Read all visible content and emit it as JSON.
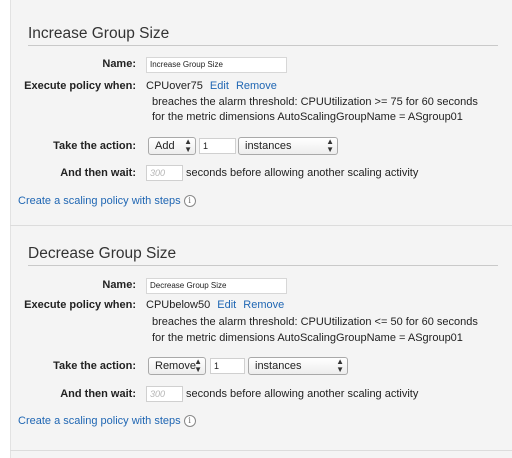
{
  "policies": [
    {
      "title": "Increase Group Size",
      "name_label": "Name:",
      "name_value": "Increase Group Size",
      "execute_label": "Execute policy when:",
      "alarm_name": "CPUover75",
      "edit_label": "Edit",
      "remove_label": "Remove",
      "breach_text": "breaches the alarm threshold: CPUUtilization >= 75 for 60 seconds",
      "dimension_text": "for the metric dimensions AutoScalingGroupName = ASgroup01",
      "action_label": "Take the action:",
      "action_value": "Add",
      "amount_value": "1",
      "unit_value": "instances",
      "wait_label": "And then wait:",
      "wait_placeholder": "300",
      "wait_suffix": "seconds before allowing another scaling activity",
      "steps_link": "Create a scaling policy with steps"
    },
    {
      "title": "Decrease Group Size",
      "name_label": "Name:",
      "name_value": "Decrease Group Size",
      "execute_label": "Execute policy when:",
      "alarm_name": "CPUbelow50",
      "edit_label": "Edit",
      "remove_label": "Remove",
      "breach_text": "breaches the alarm threshold: CPUUtilization <= 50 for 60 seconds",
      "dimension_text": "for the metric dimensions AutoScalingGroupName = ASgroup01",
      "action_label": "Take the action:",
      "action_value": "Remove",
      "amount_value": "1",
      "unit_value": "instances",
      "wait_label": "And then wait:",
      "wait_placeholder": "300",
      "wait_suffix": "seconds before allowing another scaling activity",
      "steps_link": "Create a scaling policy with steps"
    }
  ],
  "icons": {
    "info": "info-icon",
    "select_arrows": "select-arrows-icon"
  },
  "colors": {
    "link": "#1f66b3",
    "panel": "#f4f4f4"
  }
}
